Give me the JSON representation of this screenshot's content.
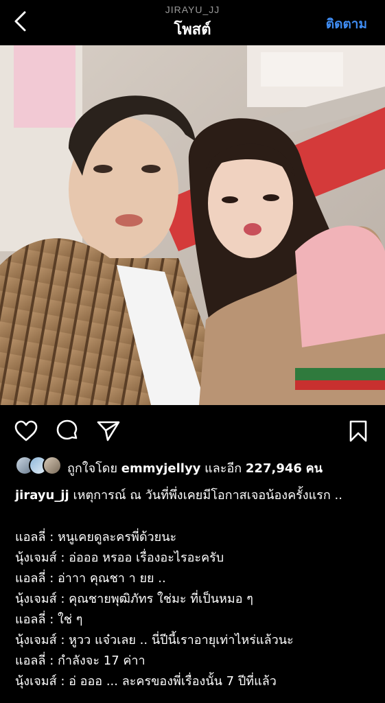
{
  "header": {
    "username": "JIRAYU_JJ",
    "title": "โพสต์",
    "follow_label": "ติดตาม",
    "back_icon": "chevron-left-icon"
  },
  "actions": {
    "like_icon": "heart-icon",
    "comment_icon": "comment-icon",
    "share_icon": "send-icon",
    "save_icon": "bookmark-icon"
  },
  "likes": {
    "prefix": "ถูกใจโดย",
    "user": "emmyjellyy",
    "middle": "และอีก",
    "count": "227,946",
    "suffix": "คน"
  },
  "caption": {
    "username": "jirayu_jj",
    "text": "เหตุการณ์ ณ วันที่พึ่งเคยมีโอกาสเจอน้องครั้งแรก .."
  },
  "dialogue": [
    "แอลลี่ : หนูเคยดูละครพี่ด้วยนะ",
    "นุ้งเจมส์ : อ่อออ หรออ เรื่องอะไรอะครับ",
    "แอลลี่ : อ่าาา คุณชา า ยย ..",
    "นุ้งเจมส์ : คุณชายพุฒิภัทร ใช่มะ ที่เป็นหมอ ๆ",
    "แอลลี่ : ใช่ ๆ",
    "นุ้งเจมส์ : หูวว แจ๋วเลย .. นี่ปีนี้เราอายุเท่าไหร่แล้วนะ",
    "แอลลี่ : กำลังจะ 17 ค่าา",
    "นุ้งเจมส์ : อ่ อออ ... ละครของพี่เรื่องนั้น 7 ปีที่แล้ว"
  ],
  "colors": {
    "background": "#000000",
    "accent": "#3f8cf2",
    "muted": "#9a9a9a"
  }
}
